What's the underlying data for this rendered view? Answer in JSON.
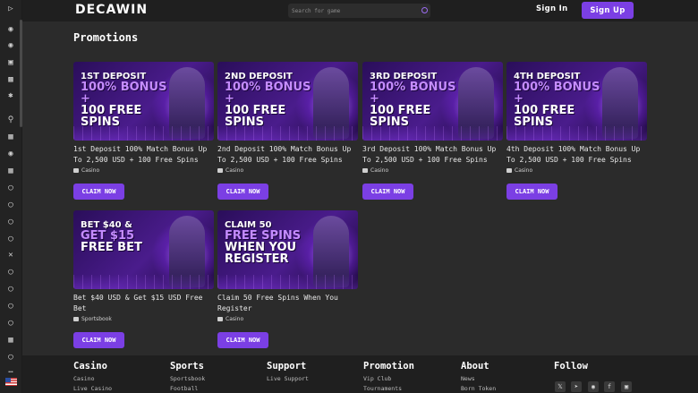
{
  "brand": {
    "logo": "DECAWIN"
  },
  "header": {
    "search_placeholder": "Search for game",
    "sign_in": "Sign In",
    "sign_up": "Sign Up"
  },
  "sidebar": {
    "icons": [
      "expand-icon",
      "basketball-icon",
      "bulldog-icon",
      "gamepad-icon",
      "gift-icon",
      "spark-icon",
      "trophy-icon",
      "calendar-icon",
      "boxing-icon",
      "fire-icon",
      "soccer-icon",
      "football-icon",
      "baseball-icon",
      "volleyball-icon",
      "hockey-icon",
      "ball-icon",
      "tennis-icon",
      "pingpong-icon",
      "cricket-icon",
      "handball-icon",
      "drink-icon",
      "rugby-icon",
      "more-icon"
    ]
  },
  "page": {
    "title": "Promotions"
  },
  "promos": [
    {
      "banner_l1": "1ST DEPOSIT",
      "banner_l2": "100% BONUS +",
      "banner_l3": "100 FREE",
      "banner_l4": "SPINS",
      "title": "1st Deposit 100% Match Bonus Up To 2,500 USD  + 100 Free Spins",
      "category": "Casino",
      "cta": "CLAIM NOW"
    },
    {
      "banner_l1": "2ND DEPOSIT",
      "banner_l2": "100% BONUS +",
      "banner_l3": "100 FREE",
      "banner_l4": "SPINS",
      "title": "2nd Deposit 100% Match Bonus Up To 2,500 USD  + 100 Free Spins",
      "category": "Casino",
      "cta": "CLAIM NOW"
    },
    {
      "banner_l1": "3RD DEPOSIT",
      "banner_l2": "100% BONUS +",
      "banner_l3": "100 FREE",
      "banner_l4": "SPINS",
      "title": "3rd Deposit 100% Match Bonus Up To 2,500 USD  + 100 Free Spins",
      "category": "Casino",
      "cta": "CLAIM NOW"
    },
    {
      "banner_l1": "4TH DEPOSIT",
      "banner_l2": "100% BONUS +",
      "banner_l3": "100 FREE",
      "banner_l4": "SPINS",
      "title": "4th Deposit 100% Match Bonus Up To 2,500 USD  + 100 Free Spins",
      "category": "Casino",
      "cta": "CLAIM NOW"
    },
    {
      "banner_l1": "BET $40 &",
      "banner_l2": "GET $15",
      "banner_l3": "FREE BET",
      "banner_l4": "",
      "title": "Bet $40 USD & Get $15 USD Free Bet",
      "category": "Sportsbook",
      "cta": "CLAIM NOW"
    },
    {
      "banner_l1": "CLAIM 50",
      "banner_l2": "FREE SPINS",
      "banner_l3": "WHEN YOU",
      "banner_l4": "REGISTER",
      "title": "Claim 50 Free Spins When You Register",
      "category": "Casino",
      "cta": "CLAIM NOW"
    }
  ],
  "footer": {
    "columns": [
      {
        "heading": "Casino",
        "links": [
          "Casino",
          "Live Casino"
        ]
      },
      {
        "heading": "Sports",
        "links": [
          "Sportsbook",
          "Football"
        ]
      },
      {
        "heading": "Support",
        "links": [
          "Live Support"
        ]
      },
      {
        "heading": "Promotion",
        "links": [
          "Vip Club",
          "Tournaments"
        ]
      },
      {
        "heading": "About",
        "links": [
          "News",
          "Born Token"
        ]
      },
      {
        "heading": "Follow",
        "links": []
      }
    ],
    "social": [
      "x-icon",
      "telegram-icon",
      "discord-icon",
      "facebook-icon",
      "instagram-icon"
    ]
  },
  "colors": {
    "accent": "#7b3fe4",
    "background": "#2b2b2b",
    "bar": "#1f1f1f"
  }
}
